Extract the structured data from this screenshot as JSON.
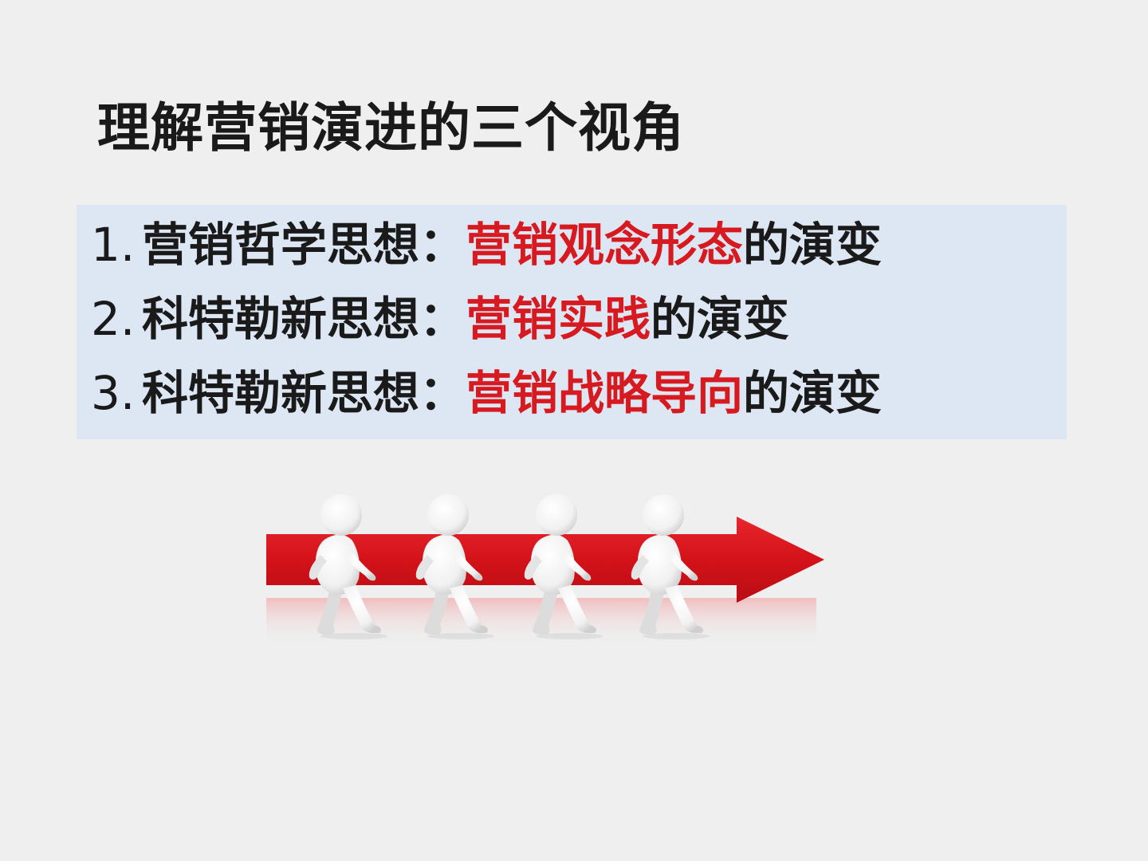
{
  "title": "理解营销演进的三个视角",
  "points": [
    {
      "number": "1.",
      "lead": "营销哲学思想：",
      "highlight": "营销观念形态",
      "tail": "的演变"
    },
    {
      "number": "2.",
      "lead": "科特勒新思想：",
      "highlight": "营销实践",
      "tail": "的演变"
    },
    {
      "number": "3.",
      "lead": "科特勒新思想：",
      "highlight": "营销战略导向",
      "tail": "的演变"
    }
  ],
  "colors": {
    "background": "#efefef",
    "box": "#dde7f3",
    "highlight": "#d71920",
    "arrow": "#d7141c"
  },
  "illustration": {
    "name": "walking-figures-red-arrow",
    "figure_count": 4
  }
}
